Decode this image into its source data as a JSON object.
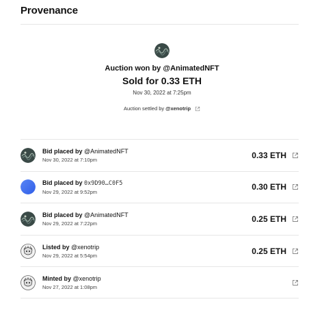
{
  "header": {
    "title": "Provenance"
  },
  "winner": {
    "won_prefix": "Auction won by ",
    "won_handle": "@AnimatedNFT",
    "sold_text": "Sold for 0.33 ETH",
    "date": "Nov 30, 2022 at 7:25pm",
    "settled_prefix": "Auction settled by ",
    "settled_handle": "@xenotrip"
  },
  "events": [
    {
      "verb": "Bid placed by",
      "who": "@AnimatedNFT",
      "date": "Nov 30, 2022 at 7:10pm",
      "price": "0.33 ETH",
      "avatar": "nft"
    },
    {
      "verb": "Bid placed by",
      "who": "0x9D90…C0F5",
      "date": "Nov 29, 2022 at 9:52pm",
      "price": "0.30 ETH",
      "avatar": "gradient"
    },
    {
      "verb": "Bid placed by",
      "who": "@AnimatedNFT",
      "date": "Nov 29, 2022 at 7:22pm",
      "price": "0.25 ETH",
      "avatar": "nft"
    },
    {
      "verb": "Listed by",
      "who": "@xenotrip",
      "date": "Nov 29, 2022 at 5:54pm",
      "price": "0.25 ETH",
      "avatar": "sketch"
    },
    {
      "verb": "Minted by",
      "who": "@xenotrip",
      "date": "Nov 27, 2022 at 1:08pm",
      "price": "",
      "avatar": "sketch"
    }
  ],
  "colors": {
    "text": "#111111",
    "muted": "#444444",
    "divider": "#e6e6e6",
    "blue_avatar": "#3d6cf0"
  },
  "icons": {
    "external_link": "external-link-icon"
  }
}
